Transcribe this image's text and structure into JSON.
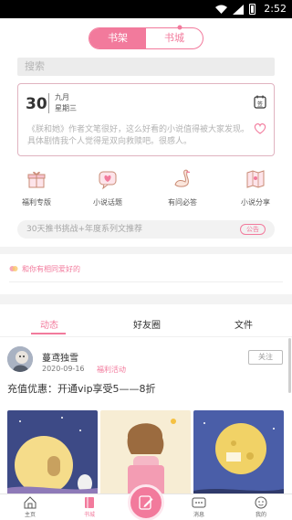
{
  "status_bar": {
    "time": "2:52"
  },
  "top_tabs": [
    {
      "label": "书架",
      "active": true
    },
    {
      "label": "书城",
      "active": false
    }
  ],
  "search": {
    "placeholder": "搜索"
  },
  "daily_card": {
    "day": "30",
    "month": "九月",
    "weekday": "星期三",
    "sign_label": "签",
    "quote": "《朕和她》作者文笔很好，这么好看的小说值得被大家发现。具体剧情我个人觉得是双向救赎吧。很感人。"
  },
  "features": [
    {
      "label": "福利专版",
      "icon": "gift-icon"
    },
    {
      "label": "小说话题",
      "icon": "heart-chat-icon"
    },
    {
      "label": "有问必答",
      "icon": "swan-icon"
    },
    {
      "label": "小说分享",
      "icon": "map-icon"
    }
  ],
  "banner": {
    "text": "30天推书挑战+年度系列文推荐",
    "badge": "公告"
  },
  "notice": {
    "text": "和你有相同爱好的"
  },
  "feed_tabs": [
    {
      "label": "动态",
      "active": true
    },
    {
      "label": "好友圈",
      "active": false
    },
    {
      "label": "文件",
      "active": false
    }
  ],
  "post": {
    "username": "蔓鸢独雪",
    "date": "2020-09-16",
    "tag": "福利活动",
    "follow_label": "关注",
    "text": "充值优惠：开通vip享受5——8折"
  },
  "bottom_nav": [
    {
      "label": "主页",
      "icon": "home-icon",
      "active": false
    },
    {
      "label": "书城",
      "icon": "book-icon",
      "active": true
    },
    {
      "label": "消息",
      "icon": "message-icon",
      "active": false
    },
    {
      "label": "我的",
      "icon": "profile-icon",
      "active": false
    }
  ],
  "colors": {
    "accent": "#f27a9c",
    "background": "#f3f3f3"
  }
}
